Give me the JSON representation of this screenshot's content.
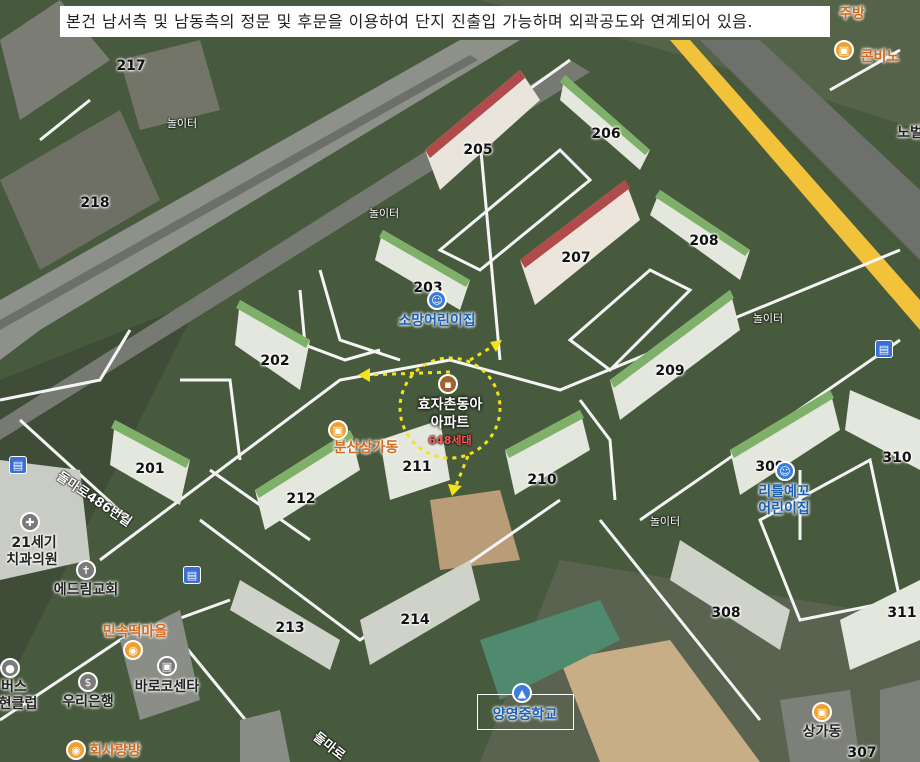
{
  "caption": "본건 남서측 및 남동측의 정문 및 후문을 이용하여 단지 진출입 가능하며 외곽공도와 연계되어 있음.",
  "complex": {
    "name_line1": "효자촌동아",
    "name_line2": "아파트",
    "units": "648세대"
  },
  "buildings": {
    "b201": "201",
    "b202": "202",
    "b203": "203",
    "b205": "205",
    "b206": "206",
    "b207": "207",
    "b208": "208",
    "b209": "209",
    "b210": "210",
    "b211": "211",
    "b212": "212",
    "b213": "213",
    "b214": "214",
    "b217": "217",
    "b218": "218",
    "b307": "307",
    "b308": "308",
    "b309": "309",
    "b310": "310",
    "b311": "311"
  },
  "playgrounds": {
    "p1": "놀이터",
    "p2": "놀이터",
    "p3": "놀이터",
    "p4": "놀이터"
  },
  "pois": {
    "somang": "소망어린이집",
    "bunsan": "분산상가동",
    "little_line1": "리틀예꼬",
    "little_line2": "어린이집",
    "dental_line1": "21세기",
    "dental_line2": "치과의원",
    "church": "에드림교회",
    "ricecake": "민속떡마을",
    "barocenter": "바로코센타",
    "woori": "우리은행",
    "bus_line1": "버스",
    "bus_line2": "현클럽",
    "sarangbang": "회사랑방",
    "school": "양영중학교",
    "sanga": "상가동",
    "convenience": "콘비노",
    "jubang": "주방",
    "nobeul": "노벌"
  },
  "streets": {
    "s1": "돌마로486번길",
    "s2": "돌마로"
  },
  "colors": {
    "arterial": "#f2c23a",
    "route_marker": "#f2e31a",
    "road": "#f4f4f4"
  },
  "icons": [
    "info-marker-icon",
    "bus-stop-icon",
    "kindergarten-icon",
    "shop-icon",
    "school-icon",
    "hospital-icon",
    "church-icon",
    "bank-icon",
    "convenience-store-icon",
    "restaurant-icon"
  ]
}
